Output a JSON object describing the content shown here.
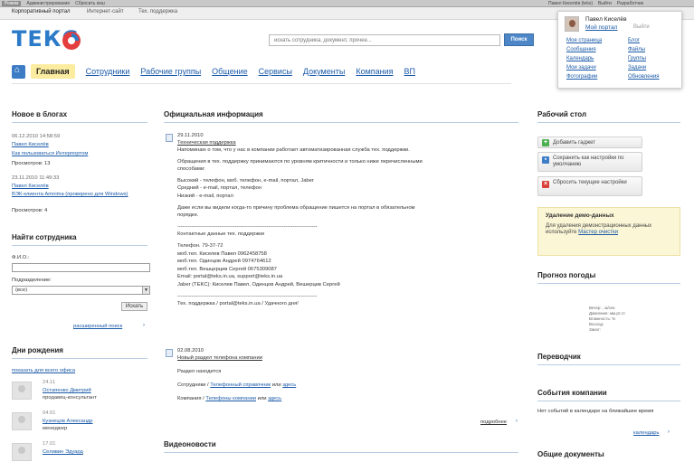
{
  "adminbar": {
    "left": [
      "Режим",
      "Администрирование",
      "Сбросить кеш"
    ],
    "right": [
      "Павел Киселёв (teks)",
      "Выйти",
      "Разработчик"
    ]
  },
  "toptabs": [
    "Корпоративный портал",
    "Интернет-сайт",
    "Тех. поддержка"
  ],
  "logo": {
    "text": "ТЕКС",
    "color": "#2b7bc9"
  },
  "search": {
    "placeholder": "искать сотрудника, документ, прочее...",
    "button": "Поиск"
  },
  "user": {
    "name": "Павел Киселёв",
    "my_portal": "Мой портал",
    "logout": "Выйти",
    "links": [
      "Моя страница",
      "Блог",
      "Сообщения",
      "Файлы",
      "Календарь",
      "Группы",
      "Мои задачи",
      "Задачи",
      "Фотографии",
      "Обновления"
    ]
  },
  "nav": {
    "active": "Главная",
    "items": [
      "Сотрудники",
      "Рабочие группы",
      "Общение",
      "Сервисы",
      "Документы",
      "Компания",
      "ВП"
    ]
  },
  "blogs": {
    "title": "Новое в блогах",
    "posts": [
      {
        "date": "06.12.2010 14:58:59",
        "author": "Павел Киселёв",
        "title": "Как пользоваться Интерпортом",
        "views": "Просмотров: 13"
      },
      {
        "date": "23.11.2010 11:49:33",
        "author": "Павел Киселёв",
        "title": "ВЭК-клиента Amnima (проверено для Windows)",
        "views": "Просмотров: 4"
      }
    ]
  },
  "find": {
    "title": "Найти сотрудника",
    "fio_label": "Ф.И.О.:",
    "dept_label": "Подразделение:",
    "dept_value": "(все)",
    "button": "Искать",
    "advanced": "расширенный поиск"
  },
  "birthdays": {
    "title": "Дни рождения",
    "show_all": "показать для всего офиса",
    "people": [
      {
        "date": "24.11",
        "name": "Остапенко Дмитрий",
        "position": "продавец-консультант"
      },
      {
        "date": "04.01",
        "name": "Кузнецов Александр",
        "position": "менеджер"
      },
      {
        "date": "17.01",
        "name": "Селивин Эдуард",
        "position": ""
      }
    ]
  },
  "official": {
    "title": "Официальная информация",
    "item1": {
      "date": "29.11.2010",
      "title": "Техническая поддержка",
      "lines": [
        "Напоминаю о том, что у нас в компании работает автоматизированная служба тех. поддержки.",
        "",
        "Обращения в тех. поддержку принимаются по уровням критичности и только ниже перечисленными",
        "способами:",
        "",
        "Высокий - телефон, моб. телефон, e-mail, портал, Jaber",
        "Средний - e-mail, портал, телефон",
        "Низкий - e-mail, портал",
        "",
        "Даже если вы видели когда-то причину проблема обращение пишется на портал в обязательном",
        "порядке.",
        "",
        "--------------------------------------------------------------------------------",
        "Контактные данные тех. поддержки",
        "",
        "Телефон. 79-37-72",
        "моб.тел. Киселев Павел 0962458758",
        "моб.тел. Одинцов Андрей 0974764612",
        "моб.тел. Вешцерцев Сергей 0675309087",
        "Email: portal@teks.in.ua, support@teks.in.ua",
        "Jaber (TEKC): Киселев Павел, Одинцов Андрей, Вешерцев Сергей",
        "",
        "--------------------------------------------------------------------------------",
        "Тех. поддержка / portal@teks.in.ua / Удачного дня!"
      ]
    },
    "item2": {
      "date": "02.08.2010",
      "title": "Новый раздел телефона компании",
      "line1": "Раздел находится",
      "line2_prefix": "Сотрудники / ",
      "line2_link": "Телефонный справочник",
      "line2_mid": " или ",
      "line2_link2": "здесь",
      "line3_prefix": "Компания / ",
      "line3_link": "Телефоны компании",
      "line3_mid": " или ",
      "line3_link2": "здесь"
    },
    "more": "подробнее"
  },
  "video": {
    "title": "Видеоновости"
  },
  "desktop": {
    "title": "Рабочий стол",
    "add": "Добавить гаджет",
    "save": "Сохранить как настройки по умолчанию",
    "reset": "Сбросить текущие настройки"
  },
  "notice": {
    "title": "Удаление демо-данных",
    "text_prefix": "Для удаления демонстрационных данных используйте ",
    "link": "Мастер очистки"
  },
  "weather": {
    "title": "Прогноз погоды",
    "lines": [
      "Ветер: , м/сек",
      "Давление: мм.рт.ст.",
      "Влажность: %",
      "Восход:",
      "Закат:"
    ]
  },
  "translator": {
    "title": "Переводчик"
  },
  "events": {
    "title": "События компании",
    "text": "Нет событий в календаре на ближайшее время",
    "link": "календарь"
  },
  "docs": {
    "title": "Общие документы"
  },
  "colors": {
    "link": "#1a5aa8",
    "accent": "#2b7bc9",
    "active_tab": "#fbeca0",
    "notice_bg": "#fbf6d6"
  }
}
